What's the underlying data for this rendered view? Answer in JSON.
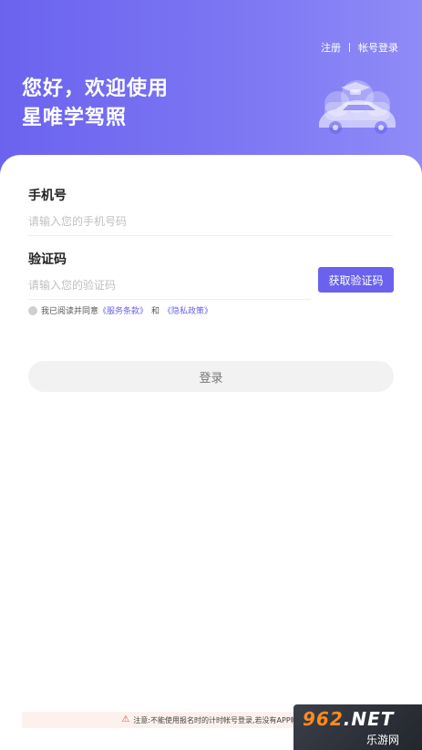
{
  "header": {
    "register_label": "注册",
    "account_login_label": "帐号登录",
    "welcome_line1": "您好，欢迎使用",
    "welcome_line2": "星唯学驾照",
    "gradient_start": "#6b63ef",
    "gradient_end": "#8f8bf7",
    "illustration_icon": "car-with-graduation-cap"
  },
  "form": {
    "phone_label": "手机号",
    "phone_placeholder": "请输入您的手机号码",
    "code_label": "验证码",
    "code_placeholder": "请输入您的验证码",
    "get_code_label": "获取验证码",
    "accent_color": "#6a62ee"
  },
  "agreement": {
    "prefix": "我已阅读并同意",
    "service_terms": "《服务条款》",
    "and": "和",
    "privacy_policy": "《隐私政策》"
  },
  "login_button_label": "登录",
  "notice": {
    "icon": "warning-icon",
    "text": "注意:不能使用报名时的计时帐号登录,若没有APP帐号"
  },
  "watermark": {
    "brand_num": "962",
    "brand_suffix": ".NET",
    "sub": "乐游网"
  }
}
